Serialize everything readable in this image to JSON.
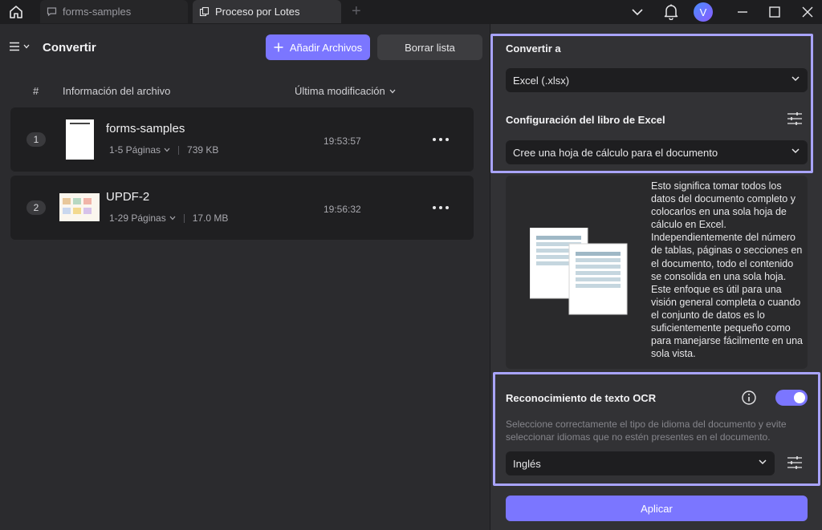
{
  "titlebar": {
    "tabs": [
      {
        "label": "forms-samples",
        "icon": "comment-icon",
        "active": false
      },
      {
        "label": "Proceso por Lotes",
        "icon": "batch-icon",
        "active": true
      }
    ],
    "new_tab_label": "+",
    "avatar_letter": "V"
  },
  "left": {
    "title": "Convertir",
    "add_button": "Añadir Archivos",
    "clear_button": "Borrar lista",
    "columns": {
      "index": "#",
      "file_info": "Información del archivo",
      "modified": "Última modificación"
    },
    "files": [
      {
        "index": "1",
        "name": "forms-samples",
        "pages": "1-5 Páginas",
        "size": "739 KB",
        "time": "19:53:57"
      },
      {
        "index": "2",
        "name": "UPDF-2",
        "pages": "1-29 Páginas",
        "size": "17.0 MB",
        "time": "19:56:32"
      }
    ]
  },
  "right": {
    "convert_to_label": "Convertir a",
    "convert_to_value": "Excel (.xlsx)",
    "workbook_label": "Configuración del libro de Excel",
    "workbook_value": "Cree una hoja de cálculo para el documento",
    "workbook_description": "Esto significa tomar todos los datos del documento completo y colocarlos en una sola hoja de cálculo en Excel. Independientemente del número de tablas, páginas o secciones en el documento, todo el contenido se consolida en una sola hoja. Este enfoque es útil para una visión general completa o cuando el conjunto de datos es lo suficientemente pequeño como para manejarse fácilmente en una sola vista.",
    "ocr_label": "Reconocimiento de texto OCR",
    "ocr_enabled": true,
    "ocr_description": "Seleccione correctamente el tipo de idioma del documento y evite seleccionar idiomas que no estén presentes en el documento.",
    "language_value": "Inglés",
    "apply_button": "Aplicar"
  },
  "colors": {
    "accent": "#7b76ff",
    "highlight": "#a9a4ff",
    "background": "#2b2b2e",
    "panel": "#323235"
  }
}
